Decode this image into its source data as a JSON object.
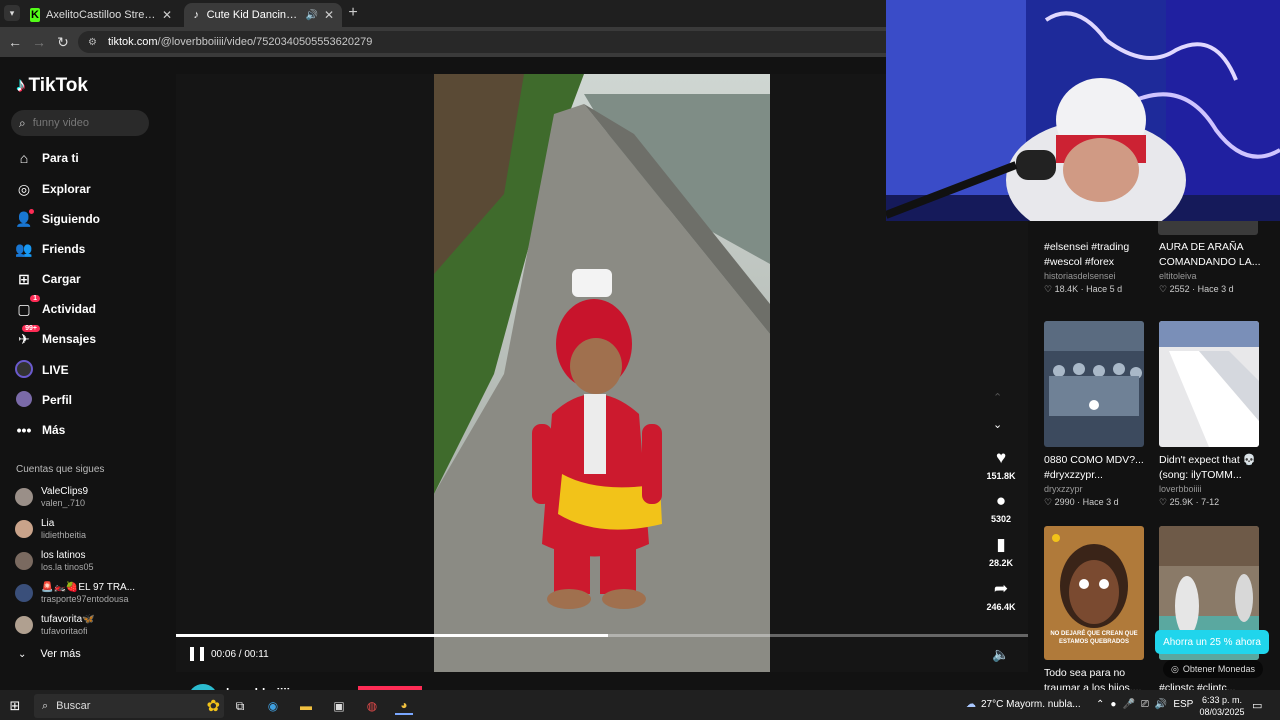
{
  "browser": {
    "tabs": [
      {
        "title": "AxelitoCastilloo Stream - Watch",
        "icon": "kick-icon",
        "active": false
      },
      {
        "title": "Cute Kid Dancing to ilyTOMMY",
        "icon": "tiktok-icon",
        "active": true
      }
    ],
    "url_host": "tiktok.com",
    "url_path": "/@loverbboiiii/video/7520340505553620279"
  },
  "tiktok": {
    "logo_text": "TikTok",
    "search_placeholder": "funny video",
    "nav": [
      {
        "label": "Para ti",
        "icon": "home-icon"
      },
      {
        "label": "Explorar",
        "icon": "compass-icon"
      },
      {
        "label": "Siguiendo",
        "icon": "following-icon"
      },
      {
        "label": "Friends",
        "icon": "friends-icon"
      },
      {
        "label": "Cargar",
        "icon": "upload-icon"
      },
      {
        "label": "Actividad",
        "icon": "inbox-icon",
        "badge": "1"
      },
      {
        "label": "Mensajes",
        "icon": "messages-icon",
        "badge": "99+"
      },
      {
        "label": "LIVE",
        "icon": "live-icon"
      },
      {
        "label": "Perfil",
        "icon": "profile-icon"
      },
      {
        "label": "Más",
        "icon": "more-icon"
      }
    ],
    "following_title": "Cuentas que sigues",
    "following": [
      {
        "name": "ValeClips9",
        "user": "valen_.710",
        "color": "#9a8f88"
      },
      {
        "name": "Lia",
        "user": "lidiethbeitia",
        "color": "#c9a38a"
      },
      {
        "name": "los latinos",
        "user": "los.la tinos05",
        "color": "#7a6a60"
      },
      {
        "name": "🚨🏍️🍓EL 97 TRA...",
        "user": "trasporte97entodousa",
        "color": "#3a4f7a"
      },
      {
        "name": "tufavorita🦋",
        "user": "tufavoritaofi",
        "color": "#b0a090"
      }
    ],
    "see_more": "Ver más"
  },
  "player": {
    "time": "00:06 / 00:11",
    "progress": 0.507,
    "uploader": "loverbboiiii",
    "actions": [
      {
        "icon": "heart-icon",
        "glyph": "♥",
        "count": "151.8K"
      },
      {
        "icon": "comment-icon",
        "glyph": "●",
        "count": "5302"
      },
      {
        "icon": "bookmark-icon",
        "glyph": "▮",
        "count": "28.2K"
      },
      {
        "icon": "share-icon",
        "glyph": "➦",
        "count": "246.4K"
      }
    ]
  },
  "recommendations": [
    {
      "title": "#elsensei #trading #wescol #forex",
      "user": "historiasdelsensei",
      "likes": "18.4K",
      "age": "Hace 5 d"
    },
    {
      "title": "AURA DE ARAÑA COMANDANDO LA...",
      "user": "eltitoleiva",
      "likes": "2552",
      "age": "Hace 3 d"
    },
    {
      "title": "0880 COMO MDV?... #dryxzzypr...",
      "user": "dryxzzypr",
      "likes": "2990",
      "age": "Hace 3 d"
    },
    {
      "title": "Didn't expect that 💀 (song: ilyTOMM...",
      "user": "loverbboiiii",
      "likes": "25.9K",
      "age": "7-12"
    },
    {
      "title": "Todo sea para no traumar a los hijos....",
      "thumb_caption": "NO DEJARÉ QUE CREAN QUE ESTAMOS QUEBRADOS"
    },
    {
      "title": "#clipstc #cliptc..."
    }
  ],
  "promo": {
    "text": "Ahorra un 25 % ahora",
    "coins": "Obtener Monedas"
  },
  "taskbar": {
    "search": "Buscar",
    "weather": "27°C  Mayorm. nubla...",
    "lang": "ESP",
    "time": "6:33 p. m.",
    "date": "08/03/2025"
  }
}
